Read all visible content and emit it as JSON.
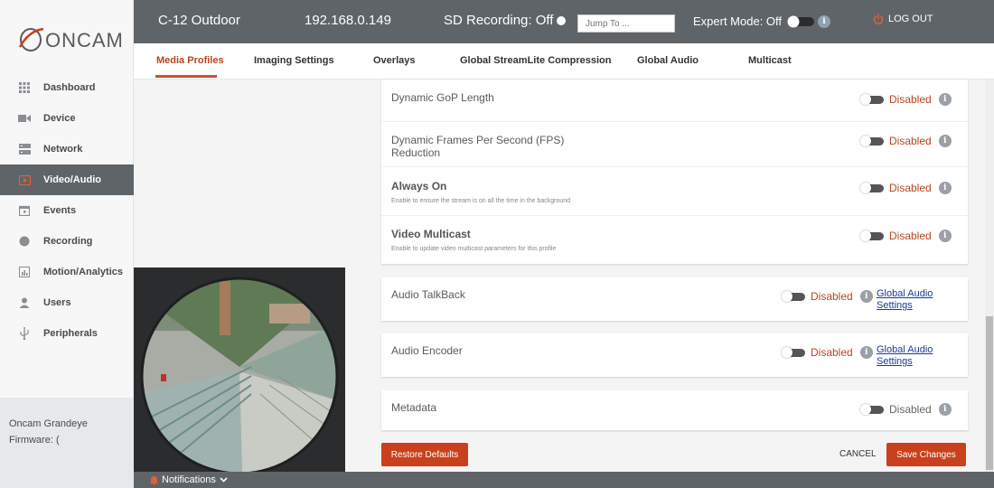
{
  "brand": {
    "logo_text": "ONCAM"
  },
  "sidebar": {
    "items": [
      {
        "label": "Dashboard",
        "icon": "grid-icon"
      },
      {
        "label": "Device",
        "icon": "camera-icon"
      },
      {
        "label": "Network",
        "icon": "server-icon"
      },
      {
        "label": "Video/Audio",
        "icon": "play-icon",
        "active": true
      },
      {
        "label": "Events",
        "icon": "calendar-icon"
      },
      {
        "label": "Recording",
        "icon": "record-icon"
      },
      {
        "label": "Motion/Analytics",
        "icon": "bar-chart-icon"
      },
      {
        "label": "Users",
        "icon": "user-icon"
      },
      {
        "label": "Peripherals",
        "icon": "usb-icon"
      }
    ],
    "device_info": {
      "model": "Oncam Grandeye",
      "firmware_label": "Firmware: ("
    }
  },
  "header": {
    "camera_name": "C-12 Outdoor",
    "ip": "192.168.0.149",
    "sd_recording": "SD Recording: Off",
    "jump_placeholder": "Jump To ...",
    "expert_mode": "Expert Mode: Off",
    "logout": "LOG OUT"
  },
  "tabs": [
    {
      "label": "Media Profiles",
      "active": true
    },
    {
      "label": "Imaging Settings"
    },
    {
      "label": "Overlays"
    },
    {
      "label": "Global StreamLite Compression"
    },
    {
      "label": "Global Audio"
    },
    {
      "label": "Multicast"
    }
  ],
  "settings": {
    "dynamic_gop": {
      "title": "Dynamic GoP Length",
      "state": "Disabled"
    },
    "dynamic_fps": {
      "title_line1": "Dynamic Frames Per Second (FPS)",
      "title_line2": "Reduction",
      "state": "Disabled"
    },
    "always_on": {
      "title": "Always On",
      "desc": "Enable to ensure the stream is on all the time in the background",
      "state": "Disabled"
    },
    "video_multicast": {
      "title": "Video Multicast",
      "desc": "Enable to update video multicast parameters for this profile",
      "state": "Disabled"
    },
    "audio_talkback": {
      "title": "Audio TalkBack",
      "state": "Disabled",
      "link_line1": "Global Audio",
      "link_line2": "Settings"
    },
    "audio_encoder": {
      "title": "Audio Encoder",
      "state": "Disabled",
      "link_line1": "Global Audio",
      "link_line2": "Settings"
    },
    "metadata": {
      "title": "Metadata",
      "state": "Disabled"
    }
  },
  "footer": {
    "restore": "Restore Defaults",
    "cancel": "CANCEL",
    "save": "Save Changes"
  },
  "bottom_bar": {
    "notifications": "Notifications"
  },
  "colors": {
    "accent": "#c9411c",
    "header_bg": "#5f6468",
    "disabled_text": "#b74520"
  }
}
